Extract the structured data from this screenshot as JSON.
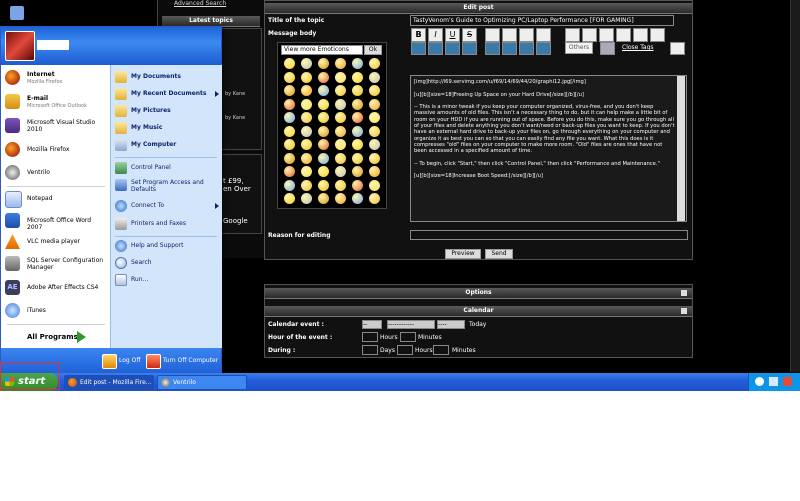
{
  "taskbar": {
    "start_label": "start",
    "tasks": [
      {
        "label": "Edit post - Mozilla Fire..."
      },
      {
        "label": "Ventrilo"
      }
    ]
  },
  "forum": {
    "top_link": "Advanced Search",
    "latest_topics_header": "Latest topics",
    "sidebar_fragments": [
      "by Kane",
      "by Kane",
      "t £99,",
      "en Over",
      "Google"
    ],
    "edit_post_header": "Edit post",
    "title_label": "Title of the topic",
    "title_value": "TastyVenom's Guide to Optimizing PC/Laptop Performance [FOR GAMING]",
    "message_body_label": "Message body",
    "emoticons_select": "View more Emoticons",
    "emoticons_ok": "Ok",
    "toolbar": {
      "bold": "B",
      "italic": "I",
      "underline": "U",
      "strike": "S",
      "others": "Others",
      "close_tags": "Close Tags"
    },
    "message_text": "[img]http://i69.servimg.com/u/f69/14/69/44/20/graphi12.jpg[/img]\n\n[u][b][size=18]Freeing Up Space on your Hard Drive[/size][/b][/u]\n\n-- This is a minor tweak if you keep your computer organized, virus-free, and you don't keep massive amounts of old files. This isn't a necessary thing to do, but it can help make a little bit of room on your HDD if you are running out of space. Before you do this, make sure you go through all of your files and delete anything you don't want/need or back-up files you want to keep. If you don't have an external hard drive to back-up your files on, go through everything on your computer and organize it as best you can so that you can easily find any file you want. What this does is it compresses \"old\" files on your computer to make more room. \"Old\" files are ones that have not been accessed in a specified amount of time.\n\n-- To begin, click \"Start,\" then click \"Control Panel,\" then click \"Performance and Maintenance.\"\n\n[u][b][size=18]Increase Boot Speed:[/size][/b][/u]",
    "reason_label": "Reason for editing",
    "preview_button": "Preview",
    "send_button": "Send",
    "options_header": "Options",
    "calendar_header": "Calendar",
    "calendar_event_label": "Calendar event :",
    "calendar_day": "--",
    "calendar_month": "------------",
    "calendar_year": "----",
    "calendar_today": "Today",
    "hour_label": "Hour of the event :",
    "hours_unit": "Hours",
    "minutes_unit": "Minutes",
    "during_label": "During :",
    "days_unit": "Days"
  },
  "startmenu": {
    "left_items": [
      {
        "title": "Internet",
        "sub": "Mozilla Firefox",
        "icon": "firefox-icon"
      },
      {
        "title": "E-mail",
        "sub": "Microsoft Office Outlook",
        "icon": "outlook-icon"
      },
      {
        "title": "Microsoft Visual Studio 2010",
        "sub": "",
        "icon": "visual-studio-icon"
      },
      {
        "title": "Mozilla Firefox",
        "sub": "",
        "icon": "firefox-icon"
      },
      {
        "title": "Ventrilo",
        "sub": "",
        "icon": "ventrilo-icon"
      },
      {
        "title": "Notepad",
        "sub": "",
        "icon": "notepad-icon"
      },
      {
        "title": "Microsoft Office Word 2007",
        "sub": "",
        "icon": "word-icon"
      },
      {
        "title": "VLC media player",
        "sub": "",
        "icon": "vlc-icon"
      },
      {
        "title": "SQL Server Configuration Manager",
        "sub": "",
        "icon": "sql-server-icon"
      },
      {
        "title": "Adobe After Effects CS4",
        "sub": "",
        "icon": "after-effects-icon"
      },
      {
        "title": "iTunes",
        "sub": "",
        "icon": "itunes-icon"
      }
    ],
    "all_programs": "All Programs",
    "right_items": [
      {
        "label": "My Documents",
        "icon": "folder-icon"
      },
      {
        "label": "My Recent Documents",
        "icon": "folder-icon"
      },
      {
        "label": "My Pictures",
        "icon": "folder-icon"
      },
      {
        "label": "My Music",
        "icon": "folder-icon"
      },
      {
        "label": "My Computer",
        "icon": "computer-icon"
      },
      {
        "label": "Control Panel",
        "icon": "control-panel-icon"
      },
      {
        "label": "Set Program Access and Defaults",
        "icon": "program-defaults-icon"
      },
      {
        "label": "Connect To",
        "icon": "network-icon"
      },
      {
        "label": "Printers and Faxes",
        "icon": "printer-icon"
      },
      {
        "label": "Help and Support",
        "icon": "help-icon"
      },
      {
        "label": "Search",
        "icon": "search-icon"
      },
      {
        "label": "Run...",
        "icon": "run-icon"
      }
    ],
    "log_off": "Log Off",
    "turn_off": "Turn Off Computer"
  }
}
